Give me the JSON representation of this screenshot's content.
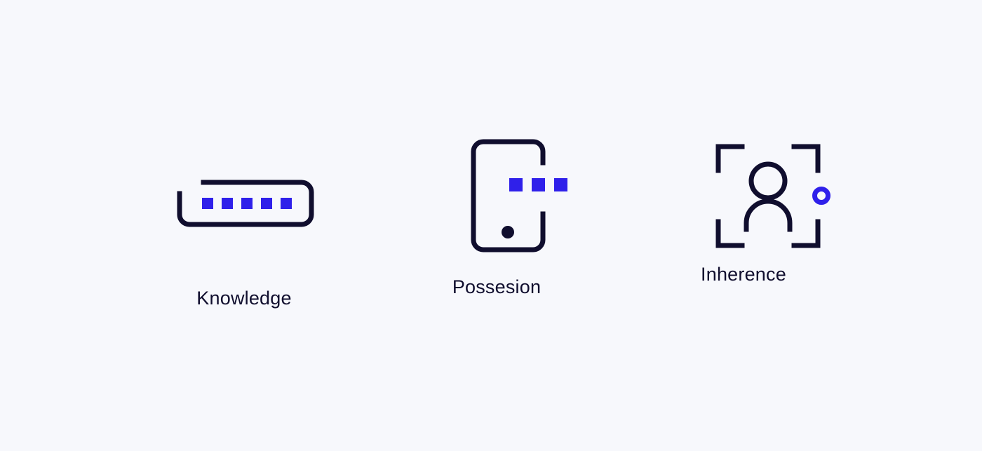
{
  "page": {
    "background_color": "#f7f8fc",
    "stroke_color": "#100e2e",
    "accent_color": "#2f20ea"
  },
  "factors": [
    {
      "id": "knowledge",
      "label": "Knowledge",
      "icon_name": "password-field-icon",
      "icon_description": "Open-cornered rounded rectangle password field containing five filled blue squares",
      "dot_count": 5,
      "dot_color": "#2f20ea",
      "stroke_color": "#100e2e"
    },
    {
      "id": "possesion",
      "label": "Possesion",
      "icon_name": "mobile-phone-icon",
      "icon_description": "Rounded rectangle phone outline with a gap on the right edge, three blue squares passing through, and a home-button dot",
      "dot_count": 3,
      "dot_color": "#2f20ea",
      "stroke_color": "#100e2e"
    },
    {
      "id": "inherence",
      "label": "Inherence",
      "icon_name": "face-scan-icon",
      "icon_description": "Four corner brackets framing a person silhouette with a blue ring on the right edge",
      "ring_color": "#2f20ea",
      "stroke_color": "#100e2e"
    }
  ]
}
